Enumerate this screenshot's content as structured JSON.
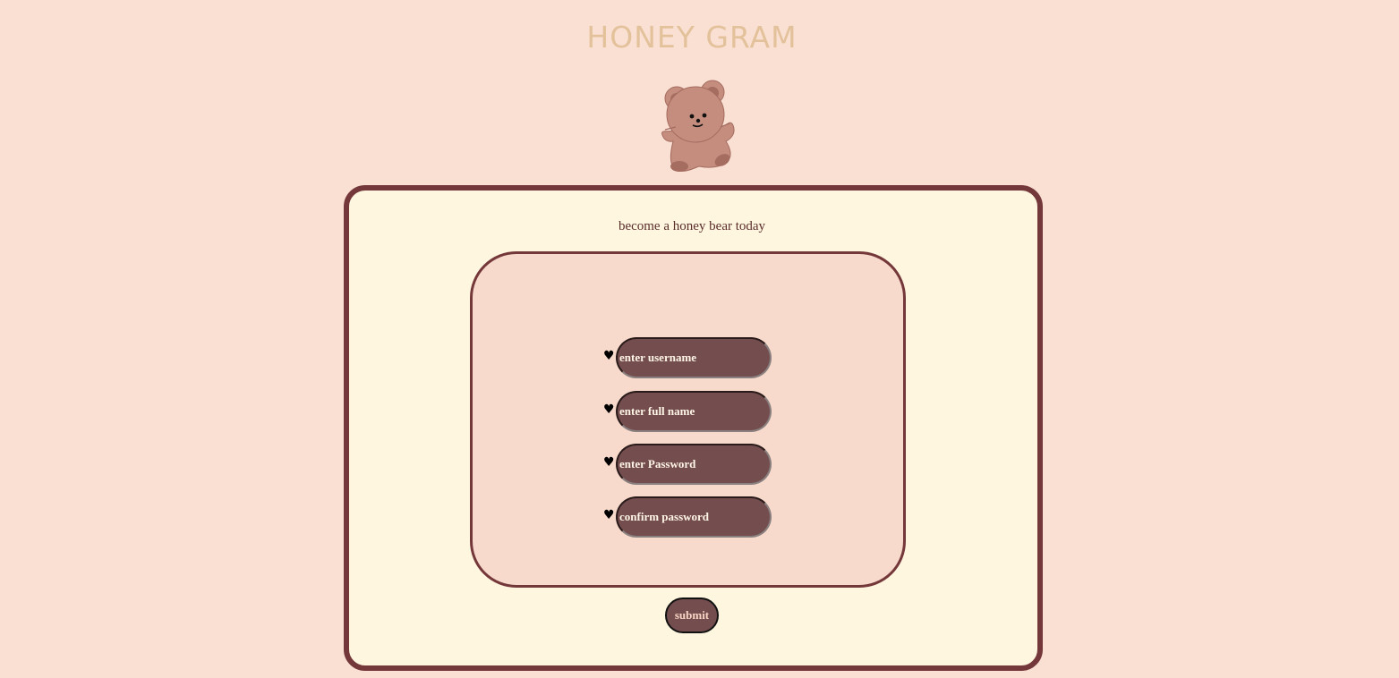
{
  "header": {
    "title": "HONEY GRAM"
  },
  "logo": {
    "icon": "teddy-bear-icon"
  },
  "form": {
    "subtitle": "become a honey bear today",
    "bullet": "♥",
    "fields": [
      {
        "name": "username",
        "placeholder": "enter username",
        "value": ""
      },
      {
        "name": "full-name",
        "placeholder": "enter full name",
        "value": ""
      },
      {
        "name": "password",
        "placeholder": "enter Password",
        "value": ""
      },
      {
        "name": "confirm-password",
        "placeholder": "confirm password",
        "value": ""
      }
    ],
    "submit_label": "submit"
  },
  "colors": {
    "page_background": "#f9e0d3",
    "title": "#e3c29b",
    "card_background": "#fff6df",
    "card_border": "#75383a",
    "inner_background": "#f7dacb",
    "field_background": "#744e4e",
    "field_text": "#fff5e6",
    "bear": "#c48d7e"
  }
}
